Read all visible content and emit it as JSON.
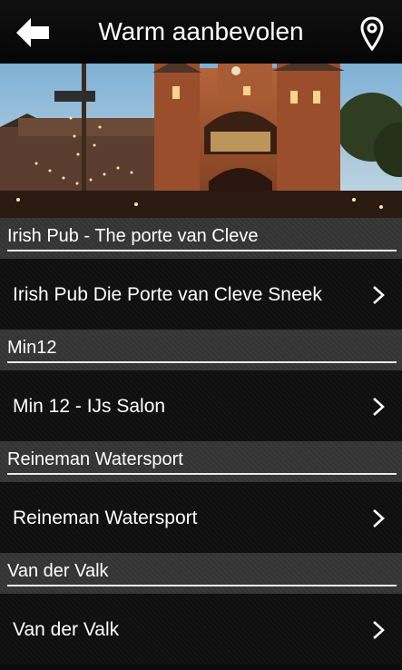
{
  "header": {
    "title": "Warm aanbevolen",
    "back_icon": "arrow-left-icon",
    "location_icon": "map-pin-icon"
  },
  "hero": {
    "image": "town gate illuminated at night"
  },
  "sections": [
    {
      "header": "Irish Pub - The porte van Cleve",
      "item": "Irish Pub Die Porte van Cleve Sneek"
    },
    {
      "header": "Min12",
      "item": "Min 12 - IJs Salon"
    },
    {
      "header": "Reineman Watersport",
      "item": "Reineman Watersport"
    },
    {
      "header": "Van der Valk",
      "item": "Van der Valk"
    }
  ],
  "colors": {
    "background": "#0b0b0b",
    "header_band": "#383838",
    "text": "#ffffff"
  }
}
